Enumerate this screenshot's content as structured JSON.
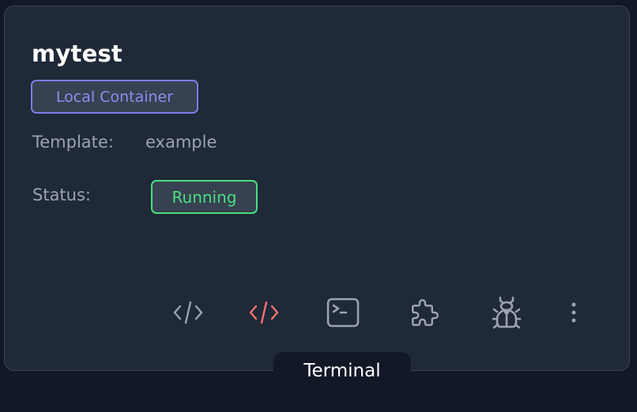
{
  "card": {
    "title": "mytest",
    "type_badge": "Local Container",
    "template_label": "Template:",
    "template_value": "example",
    "status_label": "Status:",
    "status_value": "Running"
  },
  "actions": [
    {
      "name": "code-editor",
      "icon": "code-icon",
      "color": "#9ca3af"
    },
    {
      "name": "code-editor-alt",
      "icon": "code-icon",
      "color": "#f87171"
    },
    {
      "name": "terminal",
      "icon": "terminal-icon",
      "color": "#9ca3af"
    },
    {
      "name": "extensions",
      "icon": "puzzle-icon",
      "color": "#9ca3af"
    },
    {
      "name": "debug",
      "icon": "bug-icon",
      "color": "#9ca3af"
    },
    {
      "name": "more",
      "icon": "more-vertical-icon",
      "color": "#9ca3af"
    }
  ],
  "tooltip": {
    "text": "Terminal"
  },
  "colors": {
    "page_bg": "#131827",
    "card_bg": "#1f2937",
    "badge_type": "#8b8ff0",
    "badge_status": "#4ade80",
    "muted_text": "#9ca3af",
    "accent_red": "#f87171"
  }
}
